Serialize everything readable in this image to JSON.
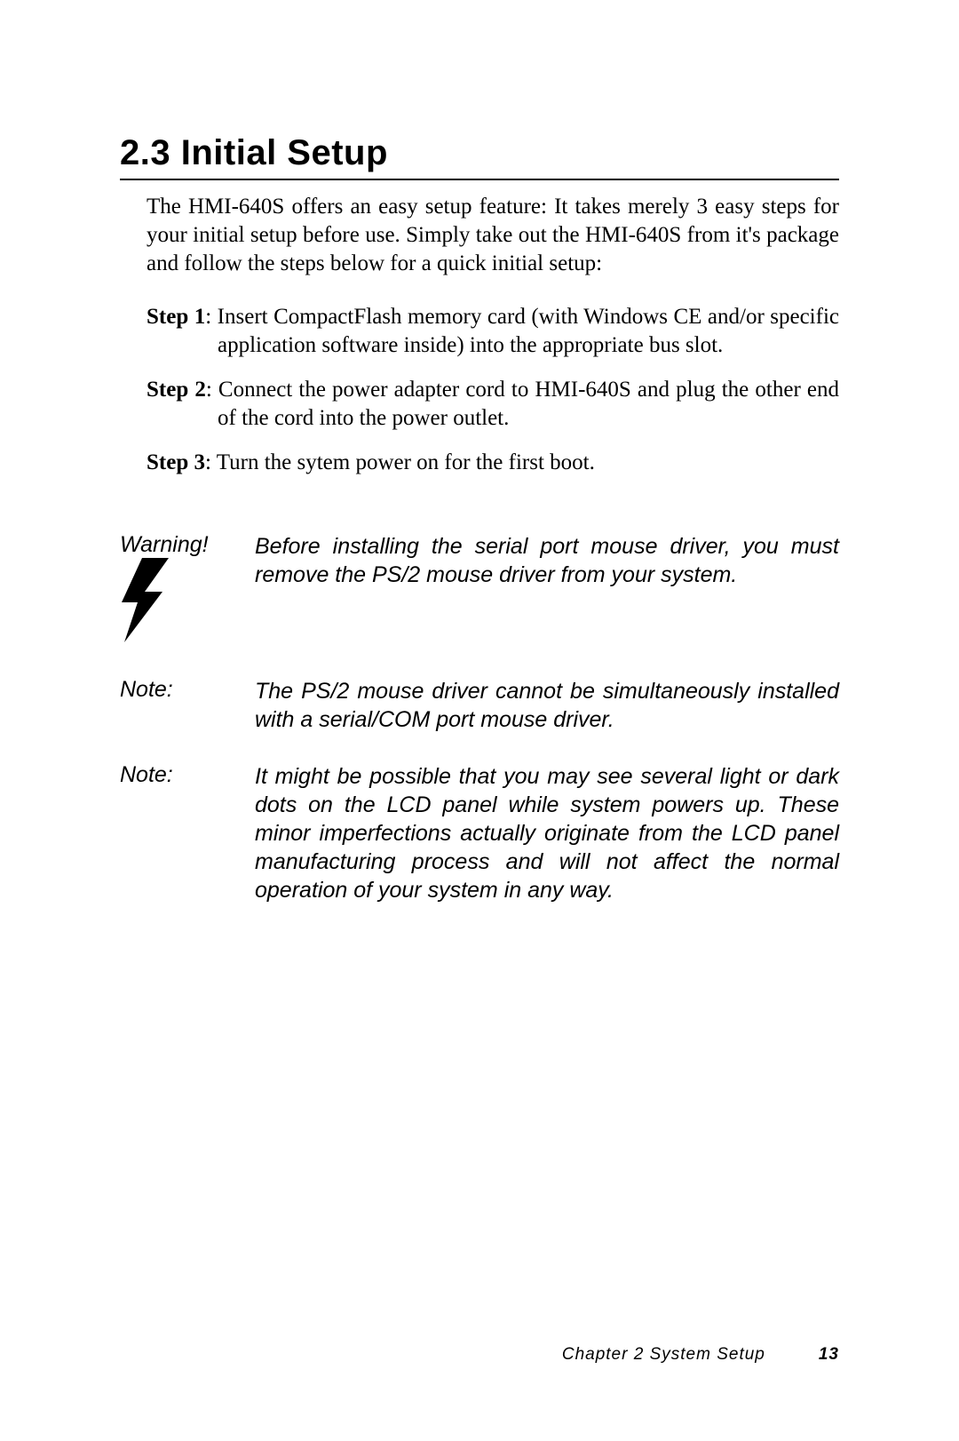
{
  "heading": {
    "number": "2.3",
    "title": "Initial Setup"
  },
  "intro": "The HMI-640S offers an easy setup feature: It takes merely 3 easy steps for your initial setup before use. Simply take out the HMI-640S from it's package and follow the steps below for a quick initial setup:",
  "steps": [
    {
      "label": "Step 1",
      "text": ": Insert  CompactFlash memory card (with Windows CE and/or specific application software inside) into the appropriate bus slot."
    },
    {
      "label": "Step 2",
      "text": ": Connect the power adapter cord to HMI-640S and plug the other end of the cord into the power outlet."
    },
    {
      "label": "Step 3",
      "text": ": Turn the sytem power on  for the first boot."
    }
  ],
  "callouts": [
    {
      "label": "Warning!",
      "icon": "lightning-bolt-icon",
      "body": "Before installing the serial port mouse driver, you must remove the PS/2 mouse driver from your system."
    },
    {
      "label": "Note:",
      "body": "The PS/2 mouse driver cannot be simultaneously installed with a serial/COM port mouse driver."
    },
    {
      "label": "Note:",
      "body": "It might be possible that you may see several light or dark dots on the LCD panel while system powers up. These minor imperfections actually originate from the LCD panel manufacturing process and will not affect the normal operation of your system in any way."
    }
  ],
  "footer": {
    "chapter": "Chapter 2   System Setup",
    "page": "13"
  }
}
